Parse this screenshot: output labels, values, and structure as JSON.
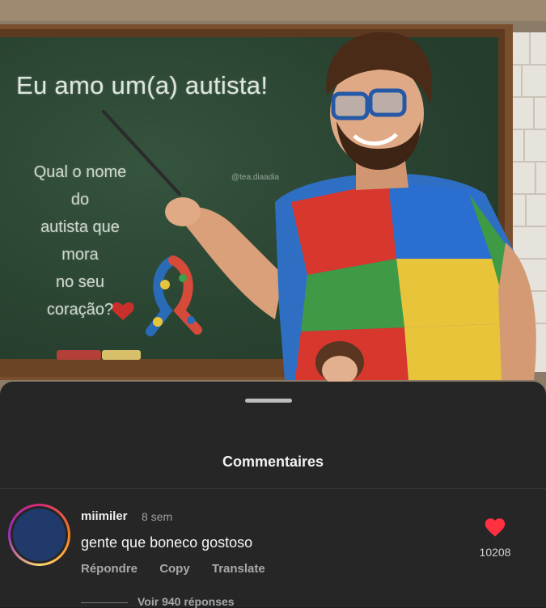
{
  "post": {
    "board_title": "Eu amo um(a) autista!",
    "board_question_lines": [
      "Qual o nome",
      "do",
      "autista que",
      "mora",
      "no seu",
      "coração?"
    ],
    "watermark": "@tea.diaadia"
  },
  "comments_sheet": {
    "title": "Commentaires",
    "comment": {
      "username": "miimiler",
      "time": "8 sem",
      "text": "gente que boneco gostoso",
      "actions": {
        "reply": "Répondre",
        "copy": "Copy",
        "translate": "Translate"
      },
      "likes": "10208",
      "view_replies": "Voir 940 réponses"
    }
  },
  "colors": {
    "chalkboard": "#2e4a36",
    "sheet_background": "#262626",
    "like_heart": "#ff3040"
  },
  "icons": {
    "heart": "heart-icon",
    "chalk-heart": "heart-icon",
    "ribbon": "puzzle-ribbon-icon"
  }
}
